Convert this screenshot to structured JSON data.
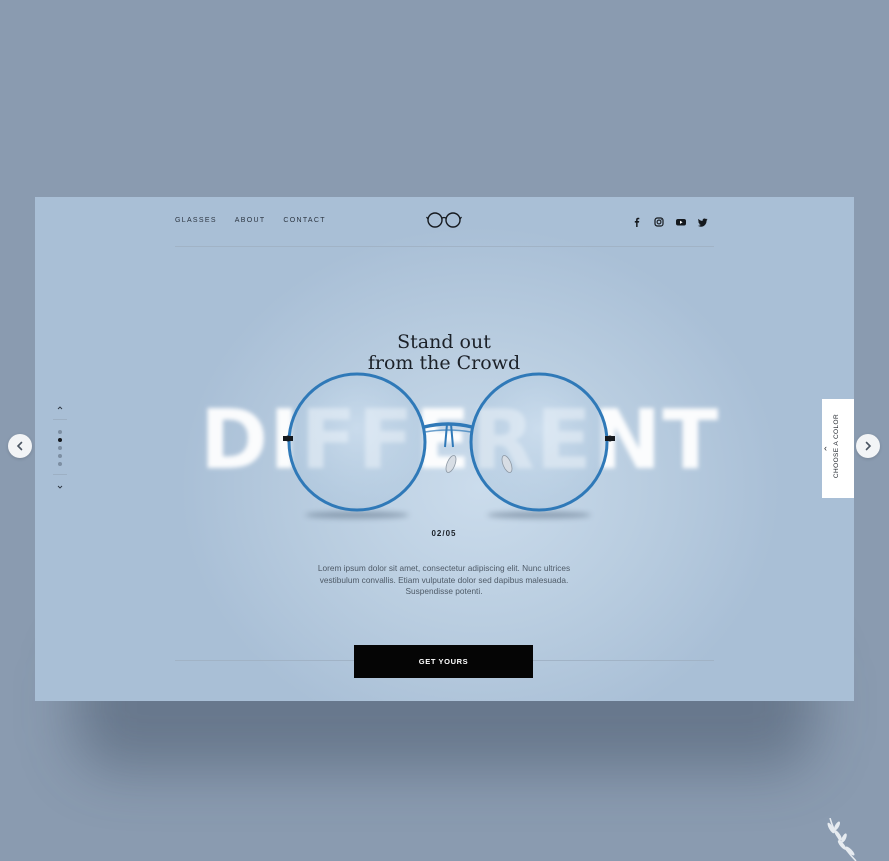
{
  "nav": {
    "items": [
      {
        "label": "GLASSES"
      },
      {
        "label": "ABOUT"
      },
      {
        "label": "CONTACT"
      }
    ]
  },
  "logo": {
    "icon": "round-glasses-icon"
  },
  "socials": [
    {
      "icon": "facebook-icon"
    },
    {
      "icon": "instagram-icon"
    },
    {
      "icon": "youtube-icon"
    },
    {
      "icon": "twitter-icon"
    }
  ],
  "hero": {
    "headline_line1": "Stand out",
    "headline_line2": "from the Crowd",
    "big_word": "DIFFERENT",
    "counter": "02/05",
    "description": "Lorem ipsum dolor sit amet, consectetur adipiscing elit. Nunc ultrices vestibulum convallis. Etiam vulputate dolor sed dapibus malesuada. Suspendisse potenti.",
    "cta_label": "GET YOURS"
  },
  "slider": {
    "current": 2,
    "total": 5
  },
  "color_tab": {
    "label": "CHOOSE A COLOR",
    "arrow": "‹"
  },
  "colors": {
    "page_background": "#8a9bb0",
    "card_background": "#b9cde0",
    "frame_blue": "#2f79b8",
    "cta_background": "#050505",
    "text_dark": "#1c2128"
  }
}
